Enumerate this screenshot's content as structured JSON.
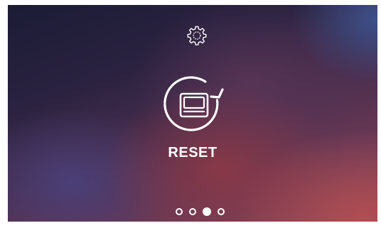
{
  "settings": {
    "icon": "gear-icon"
  },
  "reset": {
    "icon": "device-refresh-icon",
    "label": "RESET"
  },
  "pagination": {
    "total": 4,
    "active_index": 2
  },
  "colors": {
    "foreground": "#ffffff",
    "background_top_left": "#1b1c36",
    "background_bottom_right": "#b24e52",
    "background_top_right": "#3e5896"
  }
}
